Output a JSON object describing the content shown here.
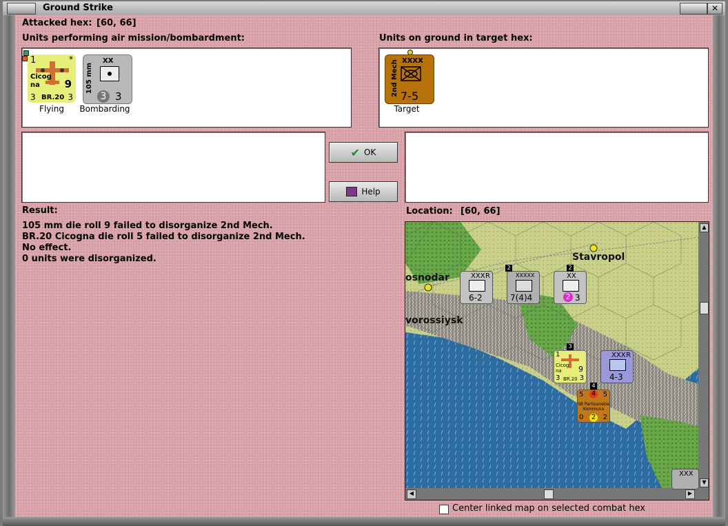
{
  "window": {
    "title": "Ground Strike"
  },
  "attacked_hex": {
    "label": "Attacked hex:",
    "value": "[60, 66]"
  },
  "air_units": {
    "heading": "Units performing air mission/bombardment:",
    "items": [
      {
        "top_left": "1",
        "name_line1": "Cicog",
        "name_line2": "na",
        "strength": "9",
        "model": "BR.20",
        "bottom_left": "3",
        "bottom_right": "3",
        "corner": "*",
        "caption": "Flying"
      },
      {
        "size": "XX",
        "side_text": "105 mm",
        "bottom_left": "3",
        "bottom_right": "3",
        "caption": "Bombarding"
      }
    ]
  },
  "ground_units": {
    "heading": "Units on ground in target hex:",
    "items": [
      {
        "size": "XXXX",
        "side_text": "2nd Mech",
        "value": "7-5",
        "caption": "Target"
      }
    ]
  },
  "buttons": {
    "ok": "OK",
    "help": "Help"
  },
  "result": {
    "heading": "Result:",
    "lines": [
      "105 mm die roll 9 failed to disorganize 2nd Mech.",
      "BR.20 Cicogna die roll 5 failed to disorganize 2nd Mech.",
      "No effect.",
      "0 units were disorganized."
    ]
  },
  "location": {
    "label": "Location:",
    "value": "[60, 66]"
  },
  "map": {
    "cities": [
      "Stavropol",
      "osnodar",
      "vorossiysk"
    ],
    "counters": [
      {
        "size": "XXX",
        "value": "6-2",
        "corner": "R"
      },
      {
        "size": "XXXXX",
        "value": "7(4)4",
        "stack": "2"
      },
      {
        "size": "XX",
        "value": "3",
        "highlight": "2",
        "stack": "2"
      },
      {
        "top_left": "1",
        "strength": "9",
        "name_line1": "Cicog",
        "name_line2": "na",
        "model": "BR.20",
        "bottom_left": "3",
        "bottom_right": "3",
        "stack": "3"
      },
      {
        "size": "XXX",
        "value": "4-3",
        "corner": "R"
      },
      {
        "top_left": "5",
        "top_mid": "4",
        "top_right": "5",
        "name_line1": "SB Partizanskie",
        "name_line2": "Kommuna",
        "bottom_left": "0",
        "bottom_mid": "2",
        "bottom_right": "2",
        "stack": "4"
      },
      {
        "size": "XXX"
      }
    ]
  },
  "checkbox": {
    "label": "Center linked map on selected combat hex",
    "checked": false
  },
  "colors": {
    "client_bg": "#d9a2a8",
    "air_unit": "#e8ee7a",
    "artillery": "#b8b8b8",
    "soviet_mech": "#b8720a",
    "sea": "#2d6ca0"
  }
}
